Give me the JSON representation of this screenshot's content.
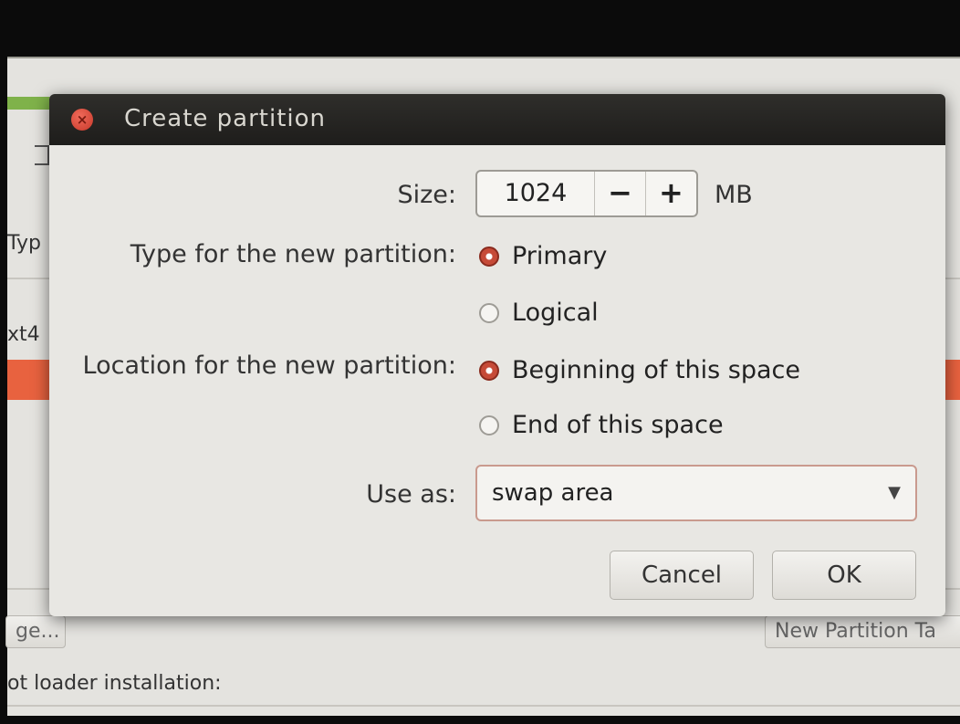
{
  "background": {
    "type_col_fragment": "Typ",
    "fs_fragment": "xt4",
    "change_button_fragment": "ge...",
    "new_partition_table_fragment": "New Partition Ta",
    "bootloader_label_fragment": "ot loader installation:"
  },
  "dialog": {
    "title": "Create partition",
    "size_label": "Size:",
    "size_value": "1024",
    "minus_label": "−",
    "plus_label": "+",
    "size_unit": "MB",
    "type_label": "Type for the new partition:",
    "type_options": [
      "Primary",
      "Logical"
    ],
    "type_selected": "Primary",
    "location_label": "Location for the new partition:",
    "location_options": [
      "Beginning of this space",
      "End of this space"
    ],
    "location_selected": "Beginning of this space",
    "use_as_label": "Use as:",
    "use_as_value": "swap area",
    "cancel_label": "Cancel",
    "ok_label": "OK"
  },
  "colors": {
    "accent": "#c64a37",
    "titlebar": "#2a2927",
    "dialog_bg": "#e8e7e3"
  }
}
